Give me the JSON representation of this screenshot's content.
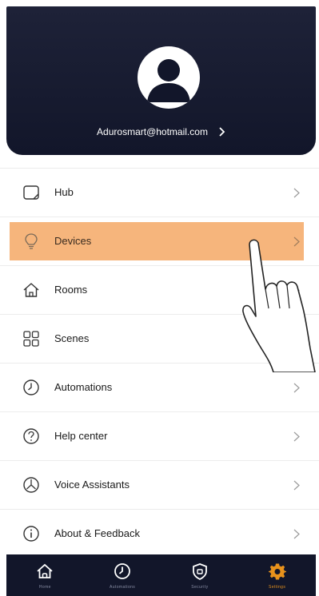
{
  "profile": {
    "email": "Adurosmart@hotmail.com"
  },
  "menu": {
    "items": [
      {
        "label": "Hub",
        "icon": "tablet-icon"
      },
      {
        "label": "Devices",
        "icon": "lightbulb-icon"
      },
      {
        "label": "Rooms",
        "icon": "home-icon"
      },
      {
        "label": "Scenes",
        "icon": "grid-icon"
      },
      {
        "label": "Automations",
        "icon": "clock-icon"
      },
      {
        "label": "Help center",
        "icon": "help-icon"
      },
      {
        "label": "Voice Assistants",
        "icon": "voice-assistant-icon"
      },
      {
        "label": "About & Feedback",
        "icon": "info-icon"
      }
    ],
    "highlighted": "Devices"
  },
  "tabbar": {
    "tabs": [
      {
        "label": "Home",
        "icon": "home-icon"
      },
      {
        "label": "Automations",
        "icon": "clock-icon"
      },
      {
        "label": "Security",
        "icon": "shield-icon"
      },
      {
        "label": "Settings",
        "icon": "gear-icon"
      }
    ],
    "active": "Settings"
  },
  "colors": {
    "header_bg": "#1e2238",
    "highlight": "#f6b67e",
    "active_tab": "#e8921c"
  }
}
